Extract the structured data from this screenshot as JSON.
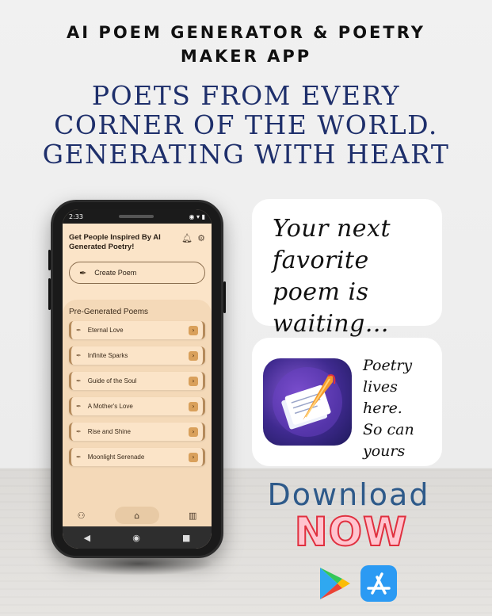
{
  "header": {
    "title_line1": "AI POEM GENERATOR & POETRY",
    "title_line2": "MAKER APP"
  },
  "headline": {
    "line1": "POETS FROM EVERY",
    "line2": "CORNER OF THE WORLD.",
    "line3": "GENERATING WITH HEART"
  },
  "phone": {
    "status_time": "2:33",
    "app_header": "Get People Inspired By AI Generated Poetry!",
    "create_button": "Create Poem",
    "section_title": "Pre-Generated Poems",
    "poems": [
      {
        "label": "Eternal Love"
      },
      {
        "label": "Infinite Sparks"
      },
      {
        "label": "Guide of the Soul"
      },
      {
        "label": "A Mother's Love"
      },
      {
        "label": "Rise and Shine"
      },
      {
        "label": "Moonlight Serenade"
      }
    ],
    "icons": [
      "bell-icon",
      "gear-icon",
      "feather-icon",
      "arrow-right-icon",
      "people-icon",
      "home-icon",
      "library-icon",
      "back-icon",
      "home-circle-icon",
      "recents-icon"
    ]
  },
  "card1": {
    "line1": "Your next",
    "line2": "favorite poem is",
    "line3": "waiting..."
  },
  "card2": {
    "line1": "Poetry",
    "line2": "lives here.",
    "line3": "So can",
    "line4": "yours"
  },
  "cta": {
    "download": "Download",
    "now": "NOW"
  },
  "stores": [
    "google-play-icon",
    "app-store-icon"
  ],
  "colors": {
    "headline": "#1e2f6b",
    "download": "#2e5a8a",
    "now_fill": "#ffc4cf",
    "now_stroke": "#e0303f",
    "app_bg": "#fbe4c8"
  }
}
